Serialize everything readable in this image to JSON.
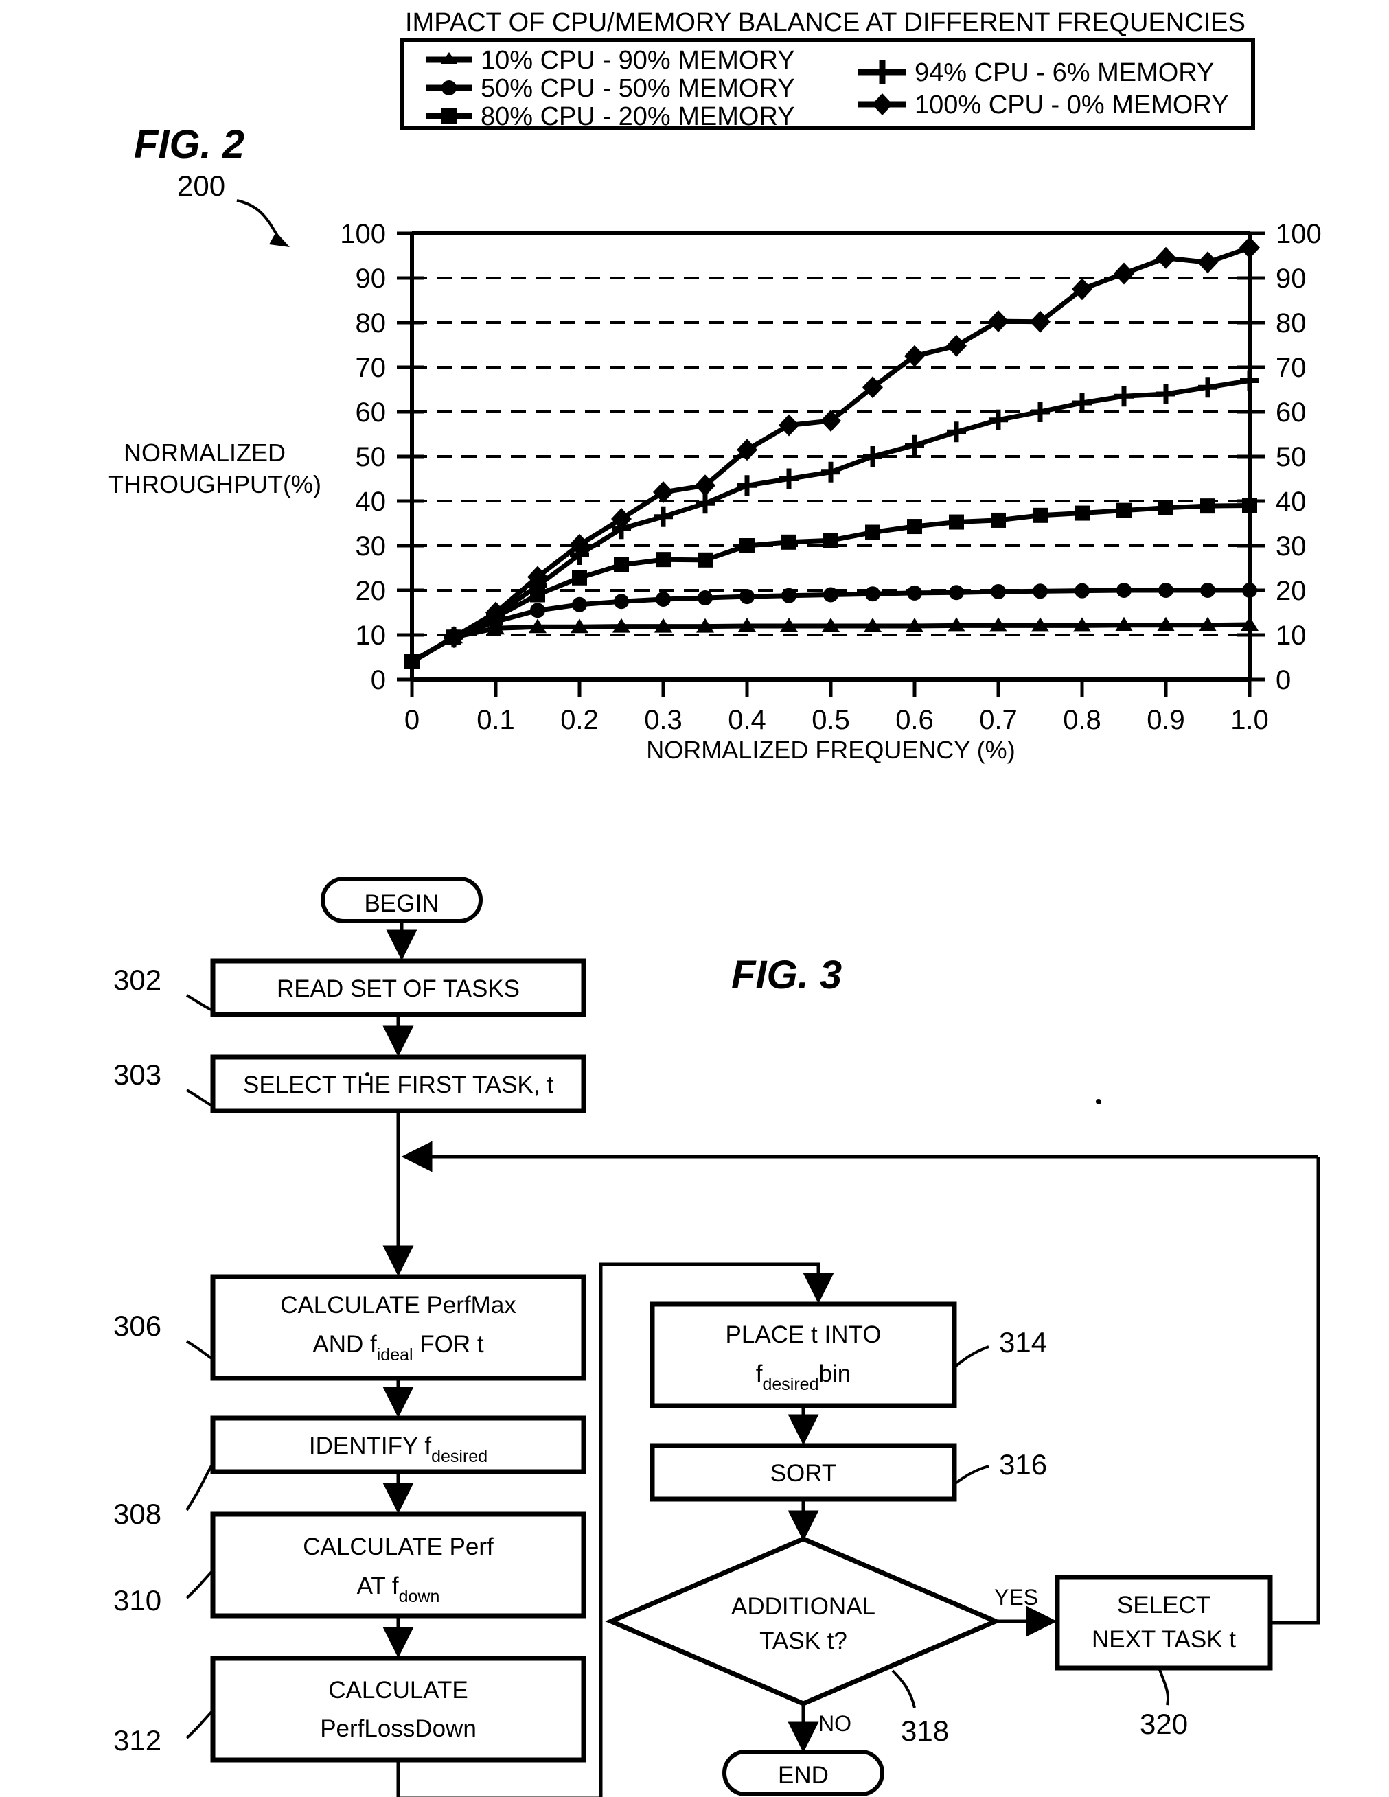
{
  "figure2": {
    "label": "FIG. 2",
    "ref_number": "200",
    "title": "IMPACT OF CPU/MEMORY BALANCE AT DIFFERENT FREQUENCIES",
    "y_axis_label_line1": "NORMALIZED",
    "y_axis_label_line2": "THROUGHPUT(%)",
    "x_axis_label": "NORMALIZED FREQUENCY (%)"
  },
  "chart_data": {
    "type": "line",
    "title": "IMPACT OF CPU/MEMORY BALANCE AT DIFFERENT FREQUENCIES",
    "xlabel": "NORMALIZED FREQUENCY (%)",
    "ylabel": "NORMALIZED THROUGHPUT(%)",
    "xlim": [
      0,
      1.0
    ],
    "ylim": [
      0,
      100
    ],
    "xticks": [
      "0",
      "0.1",
      "0.2",
      "0.3",
      "0.4",
      "0.5",
      "0.6",
      "0.7",
      "0.8",
      "0.9",
      "1.0"
    ],
    "yticks": [
      "0",
      "10",
      "20",
      "30",
      "40",
      "50",
      "60",
      "70",
      "80",
      "90",
      "100"
    ],
    "yticks_right": [
      "0",
      "10",
      "20",
      "30",
      "40",
      "50",
      "60",
      "70",
      "80",
      "90",
      "100"
    ],
    "grid": "horizontal-dashed",
    "legend_position": "top",
    "x": [
      0,
      0.05,
      0.1,
      0.15,
      0.2,
      0.25,
      0.3,
      0.35,
      0.4,
      0.45,
      0.5,
      0.55,
      0.6,
      0.65,
      0.7,
      0.75,
      0.8,
      0.85,
      0.9,
      0.95,
      1.0
    ],
    "series": [
      {
        "name": "10% CPU - 90% MEMORY",
        "marker": "triangle",
        "values": [
          4,
          9.5,
          11.5,
          11.8,
          11.8,
          11.9,
          11.9,
          11.9,
          12.0,
          12.0,
          12.0,
          12.0,
          12.0,
          12.1,
          12.1,
          12.1,
          12.1,
          12.2,
          12.2,
          12.2,
          12.3
        ]
      },
      {
        "name": "50% CPU - 50% MEMORY",
        "marker": "circle",
        "values": [
          4,
          9.5,
          13.0,
          15.5,
          16.8,
          17.5,
          18.0,
          18.3,
          18.6,
          18.8,
          19.0,
          19.2,
          19.4,
          19.5,
          19.7,
          19.8,
          19.9,
          20.0,
          20.0,
          20.0,
          20.0
        ]
      },
      {
        "name": "80% CPU - 20% MEMORY",
        "marker": "square",
        "values": [
          4,
          9.5,
          14.0,
          19.0,
          22.8,
          25.7,
          26.9,
          26.8,
          30.0,
          30.8,
          31.2,
          33.0,
          34.3,
          35.3,
          35.7,
          36.8,
          37.3,
          37.9,
          38.5,
          38.9,
          39.0
        ]
      },
      {
        "name": "94% CPU - 6% MEMORY",
        "marker": "plus",
        "values": [
          4,
          9.5,
          14.5,
          21.0,
          28.0,
          33.8,
          36.5,
          39.5,
          43.5,
          45.0,
          46.5,
          50.0,
          52.5,
          55.5,
          58.2,
          60.0,
          62.0,
          63.5,
          64.0,
          65.5,
          67.0
        ]
      },
      {
        "name": "100% CPU - 0% MEMORY",
        "marker": "diamond",
        "values": [
          4,
          9.5,
          15.0,
          23.0,
          30.2,
          36.0,
          42.0,
          43.5,
          51.5,
          57.0,
          58.0,
          65.5,
          72.5,
          74.8,
          80.3,
          80.2,
          87.5,
          91.0,
          94.5,
          93.5,
          96.8
        ]
      }
    ]
  },
  "figure3": {
    "label": "FIG. 3",
    "nodes": {
      "begin": "BEGIN",
      "end": "END",
      "n302": "READ SET OF TASKS",
      "n303": "SELECT THE FIRST TASK, t",
      "n306_line1": "CALCULATE PerfMax",
      "n306_line2_a": "AND f",
      "n306_line2_sub": "ideal",
      "n306_line2_b": "FOR t",
      "n308_a": "IDENTIFY f",
      "n308_sub": "desired",
      "n310_line1": "CALCULATE Perf",
      "n310_line2_a": "AT f",
      "n310_line2_sub": "down",
      "n312_line1": "CALCULATE",
      "n312_line2": "PerfLossDown",
      "n314_line1": "PLACE t INTO",
      "n314_line2_a": "f",
      "n314_line2_sub": "desired",
      "n314_line2_b": "bin",
      "n316": "SORT",
      "n318_line1": "ADDITIONAL",
      "n318_line2": "TASK t?",
      "n320_line1": "SELECT",
      "n320_line2": "NEXT TASK t"
    },
    "refs": {
      "r302": "302",
      "r303": "303",
      "r306": "306",
      "r308": "308",
      "r310": "310",
      "r312": "312",
      "r314": "314",
      "r316": "316",
      "r318": "318",
      "r320": "320"
    },
    "branch_yes": "YES",
    "branch_no": "NO"
  },
  "colors": {
    "ink": "#000000",
    "paper": "#ffffff"
  }
}
